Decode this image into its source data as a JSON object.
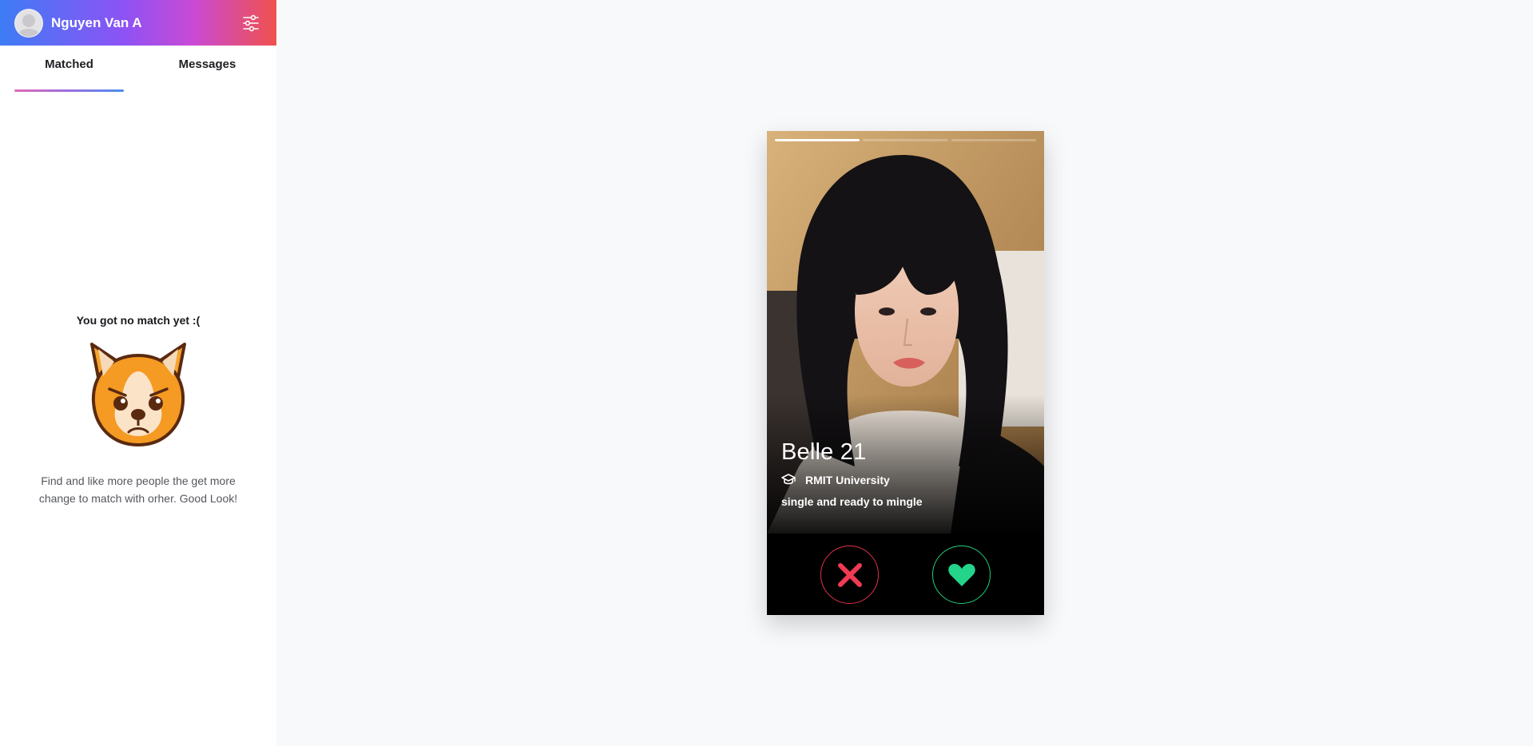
{
  "sidebar": {
    "user_name": "Nguyen Van A",
    "tabs": [
      {
        "label": "Matched",
        "active": true
      },
      {
        "label": "Messages",
        "active": false
      }
    ],
    "empty": {
      "title": "You got no match yet :(",
      "description": "Find and like more people the get more change to match with orher. Good Look!"
    }
  },
  "card": {
    "name_age": "Belle 21",
    "school": "RMIT University",
    "bio": "single and ready to mingle",
    "photo_count": 3,
    "current_photo": 1
  },
  "colors": {
    "header_gradient": [
      "#3d7cf4",
      "#8e52f5",
      "#c94ad4",
      "#f0514d"
    ],
    "nope": "#e0314c",
    "like": "#1fcf7a"
  },
  "icons": {
    "settings": "sliders-icon",
    "school": "graduation-cap-icon",
    "nope": "x-icon",
    "like": "heart-icon"
  }
}
